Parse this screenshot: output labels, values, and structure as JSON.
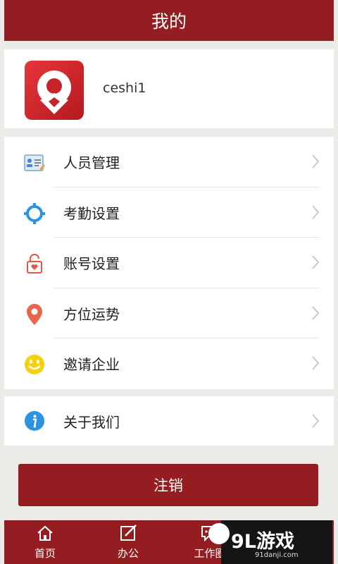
{
  "header": {
    "title": "我的"
  },
  "profile": {
    "username": "ceshi1"
  },
  "menu": {
    "group1": [
      {
        "label": "人员管理",
        "icon": "id-card-icon"
      },
      {
        "label": "考勤设置",
        "icon": "gear-icon"
      },
      {
        "label": "账号设置",
        "icon": "lock-icon"
      },
      {
        "label": "方位运势",
        "icon": "location-pin-icon"
      },
      {
        "label": "邀请企业",
        "icon": "smiley-icon"
      }
    ],
    "group2": [
      {
        "label": "关于我们",
        "icon": "info-icon"
      }
    ]
  },
  "logout": {
    "label": "注销"
  },
  "tabbar": {
    "tabs": [
      {
        "label": "首页",
        "icon": "home-icon"
      },
      {
        "label": "办公",
        "icon": "edit-icon"
      },
      {
        "label": "工作圈",
        "icon": "chat-icon"
      }
    ]
  },
  "watermark": {
    "brand": "9L游戏",
    "site": "91danji.com"
  },
  "colors": {
    "primary": "#931d20",
    "background": "#ecebe8"
  }
}
